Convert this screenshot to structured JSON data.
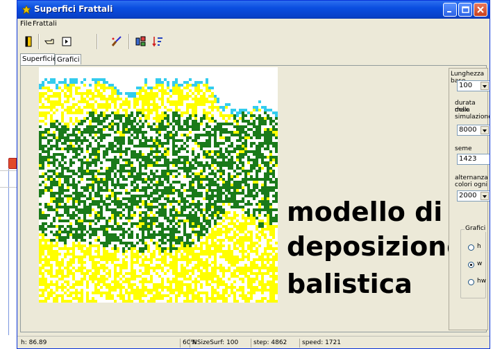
{
  "window": {
    "title": "Superfici Frattali"
  },
  "menu": {
    "file": "File",
    "frattali": "Frattali"
  },
  "toolbar": {
    "icons": [
      "door-exit-icon",
      "hand-pointer-icon",
      "step-forward-icon",
      "brush-icon",
      "palette-icon",
      "sort-icon"
    ]
  },
  "tabs": [
    {
      "label": "Superficie",
      "active": true
    },
    {
      "label": "Grafici",
      "active": false
    }
  ],
  "surface": {
    "colors": {
      "background": "#ffffff",
      "cyan": "#33ccee",
      "yellow": "#ffff00",
      "green": "#1a7a1a"
    }
  },
  "overlay": {
    "line1": "modello di",
    "line2": "deposizione",
    "line3": "balistica"
  },
  "controls": {
    "base_length_label": "Lunghezza base",
    "base_length_value": "100",
    "max_duration_label_1": "durata max",
    "max_duration_label_2": "della",
    "max_duration_label_3": "simulazione",
    "max_duration_value": "8000",
    "seed_label": "seme",
    "seed_value": "1423",
    "color_alternation_label_1": "alternanza",
    "color_alternation_label_2": "colori ogni",
    "color_alternation_value": "2000",
    "graphs_group_label": "Grafici",
    "radio_h": "h",
    "radio_w": "w",
    "radio_hw": "hw",
    "selected_graph": "w"
  },
  "status": {
    "h": "h: 86.89",
    "percent": "60%",
    "nsize": "NSizeSurf: 100",
    "step": "step: 4862",
    "speed": "speed: 1721"
  }
}
